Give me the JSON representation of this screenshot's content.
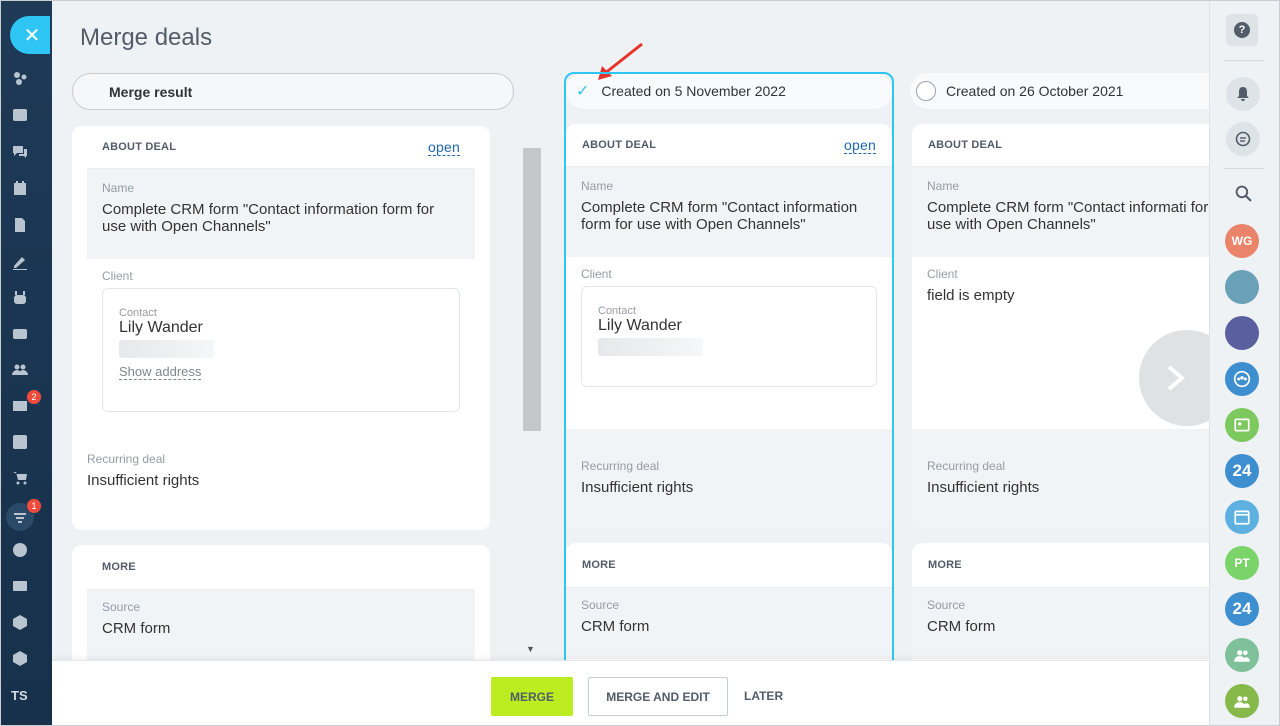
{
  "page": {
    "title": "Merge deals"
  },
  "merge_result": {
    "pill_label": "Merge result",
    "about_header": "ABOUT DEAL",
    "open_label": "open",
    "name_label": "Name",
    "name_value": "Complete CRM form \"Contact information form for use with Open Channels\"",
    "client_label": "Client",
    "contact_label": "Contact",
    "contact_name": "Lily Wander",
    "show_address": "Show address",
    "recurring_label": "Recurring deal",
    "recurring_value": "Insufficient rights",
    "more_header": "MORE",
    "source_label": "Source",
    "source_value": "CRM form"
  },
  "candidates": [
    {
      "created": "Created on 5 November 2022",
      "selected": true,
      "about_header": "ABOUT DEAL",
      "open_label": "open",
      "name_label": "Name",
      "name_value": "Complete CRM form \"Contact information form for use with Open Channels\"",
      "client_label": "Client",
      "contact_label": "Contact",
      "contact_name": "Lily Wander",
      "recurring_label": "Recurring deal",
      "recurring_value": "Insufficient rights",
      "more_header": "MORE",
      "source_label": "Source",
      "source_value": "CRM form"
    },
    {
      "created": "Created on 26 October 2021",
      "selected": false,
      "about_header": "ABOUT DEAL",
      "name_label": "Name",
      "name_value": "Complete CRM form \"Contact informati form for use with Open Channels\"",
      "client_label": "Client",
      "client_value": "field is empty",
      "recurring_label": "Recurring deal",
      "recurring_value": "Insufficient rights",
      "more_header": "MORE",
      "source_label": "Source",
      "source_value": "CRM form"
    }
  ],
  "footer": {
    "merge": "MERGE",
    "merge_and_edit": "MERGE AND EDIT",
    "later": "LATER"
  },
  "left_sidebar": {
    "close_icon": "close-icon",
    "user_initials": "TS",
    "badges": {
      "mail": "2",
      "funnel": "1"
    }
  },
  "right_sidebar": {
    "help": "?",
    "avatars": [
      {
        "initials": "WG",
        "color": "#e9846a"
      },
      {
        "initials": "",
        "color": "#6aa0b8"
      },
      {
        "initials": "",
        "color": "#5a5fa0"
      },
      {
        "initials": "",
        "color": "#3e8fd0"
      },
      {
        "initials": "",
        "color": "#7dc95f"
      },
      {
        "initials": "24",
        "color": "#3e8fd0"
      },
      {
        "initials": "",
        "color": "#5db0e0"
      },
      {
        "initials": "PT",
        "color": "#7bd46a"
      },
      {
        "initials": "24",
        "color": "#3e8fd0"
      },
      {
        "initials": "",
        "color": "#7dc09a"
      },
      {
        "initials": "",
        "color": "#86b84a"
      }
    ]
  },
  "colors": {
    "accent": "#2fc6f6",
    "merge_button": "#bbed21",
    "link": "#2067b0"
  }
}
